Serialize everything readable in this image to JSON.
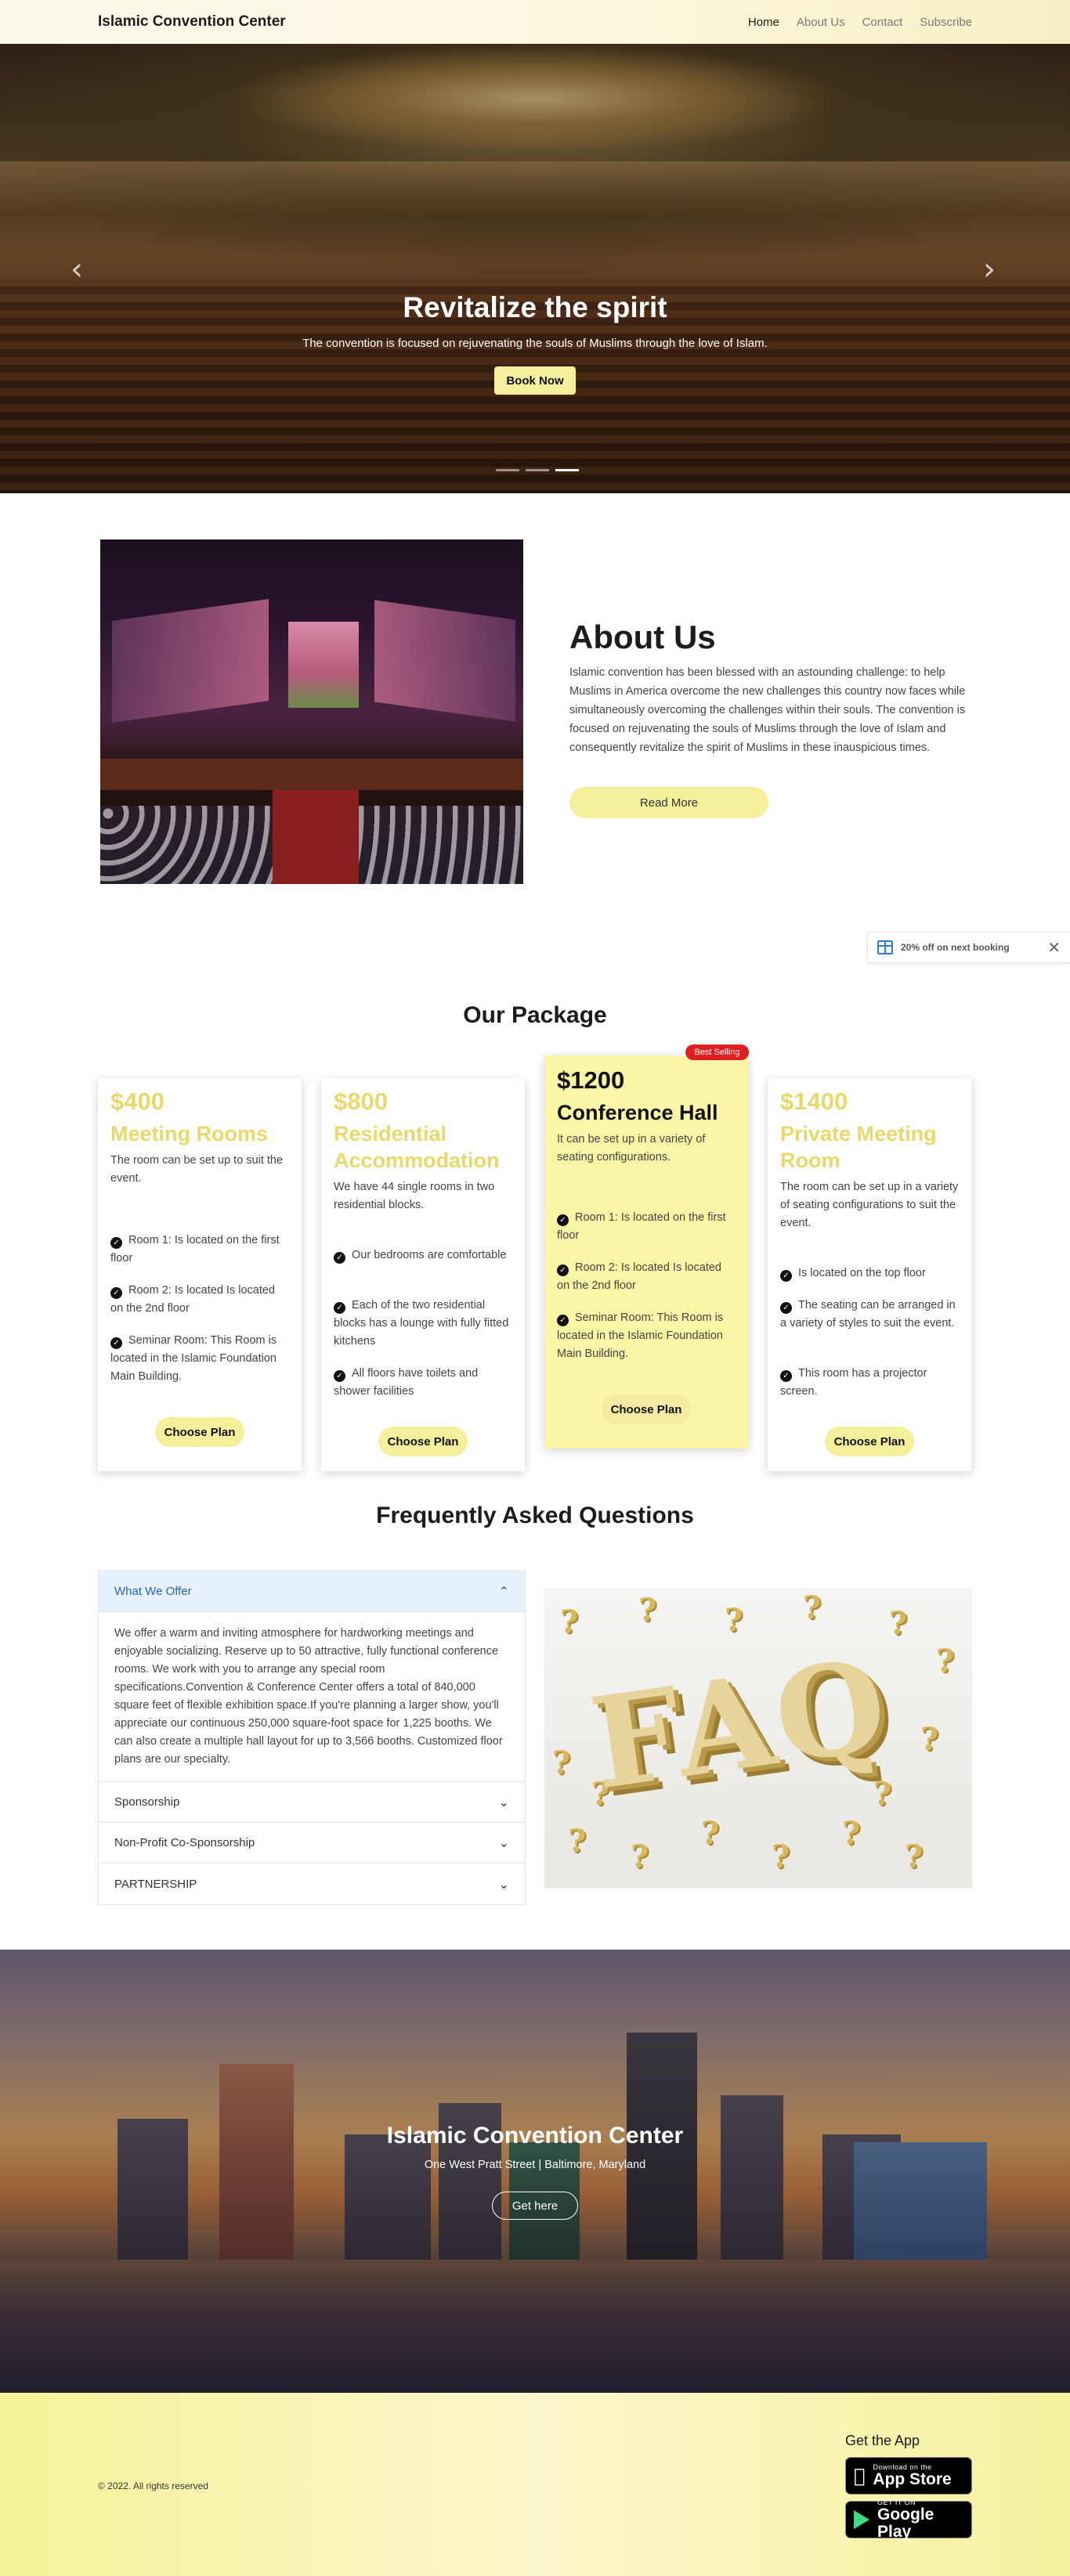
{
  "navbar": {
    "brand": "Islamic Convention Center",
    "links": [
      "Home",
      "About Us",
      "Contact",
      "Subscribe"
    ],
    "active": "Home"
  },
  "hero": {
    "title": "Revitalize the spirit",
    "subtitle": "The convention is focused on rejuvenating the souls of Muslims through the love of Islam.",
    "button": "Book Now",
    "prev_icon": "chevron-left-icon",
    "next_icon": "chevron-right-icon",
    "slides": 3,
    "active_slide": 3
  },
  "about": {
    "title": "About Us",
    "text": "Islamic convention has been blessed with an astounding challenge: to help Muslims in America overcome the new challenges this country now faces while simultaneously overcoming the challenges within their souls. The convention is focused on rejuvenating the souls of Muslims through the love of Islam and consequently revitalize the spirit of Muslims in these inauspicious times.",
    "button": "Read More"
  },
  "toast": {
    "icon": "gift-icon",
    "text": "20% off on next booking",
    "close_icon": "close-icon"
  },
  "packages": {
    "title": "Our Package",
    "badge": "Best Selling",
    "cards": [
      {
        "price": "$400",
        "name": "Meeting Rooms",
        "desc": "The room can be set up to suit the event.",
        "features": [
          "Room 1: Is located on the first floor",
          "Room 2: Is located Is located on the 2nd floor",
          "Seminar Room: This Room is located in the Islamic Foundation Main Building."
        ],
        "button": "Choose Plan"
      },
      {
        "price": "$800",
        "name": "Residential Accommodation",
        "desc": "We have 44 single rooms in two residential blocks.",
        "features": [
          "Our bedrooms are comfortable",
          "Each of the two residential blocks has a lounge with fully fitted kitchens",
          "All floors have toilets and shower facilities"
        ],
        "button": "Choose Plan"
      },
      {
        "price": "$1200",
        "name": "Conference Hall",
        "desc": "It can be set up in a variety of seating configurations.",
        "features": [
          "Room 1: Is located on the first floor",
          "Room 2: Is located Is located on the 2nd floor",
          "Seminar Room: This Room is located in the Islamic Foundation Main Building."
        ],
        "button": "Choose Plan"
      },
      {
        "price": "$1400",
        "name": "Private Meeting Room",
        "desc": "The room can be set up in a variety of seating configurations to suit the event.",
        "features": [
          "Is located on the top floor",
          "The seating can be arranged in a variety of styles to suit the event.",
          "This room has a projector screen."
        ],
        "button": "Choose Plan"
      }
    ]
  },
  "faq": {
    "title": "Frequently Asked Questions",
    "items": [
      {
        "q": "What We Offer",
        "a": "We offer a warm and inviting atmosphere for hardworking meetings and enjoyable socializing. Reserve up to 50 attractive, fully functional conference rooms. We work with you to arrange any special room specifications.Convention & Conference Center offers a total of 840,000 square feet of flexible exhibition space.If you're planning a larger show, you'll appreciate our continuous 250,000 square-foot space for 1,225 booths. We can also create a multiple hall layout for up to 3,566 booths. Customized floor plans are our specialty."
      },
      {
        "q": "Sponsorship"
      },
      {
        "q": "Non-Profit Co-Sponsorship"
      },
      {
        "q": "PARTNERSHIP"
      }
    ],
    "image_word": "FAQ"
  },
  "location": {
    "title": "Islamic Convention Center",
    "address": "One West Pratt Street | Baltimore, Maryland",
    "button": "Get here"
  },
  "footer": {
    "copyright": "© 2022. All rights reserved",
    "get_app": "Get the App",
    "app_store_small": "Download on the",
    "app_store_big": "App Store",
    "play_small": "GET IT ON",
    "play_big": "Google Play"
  }
}
